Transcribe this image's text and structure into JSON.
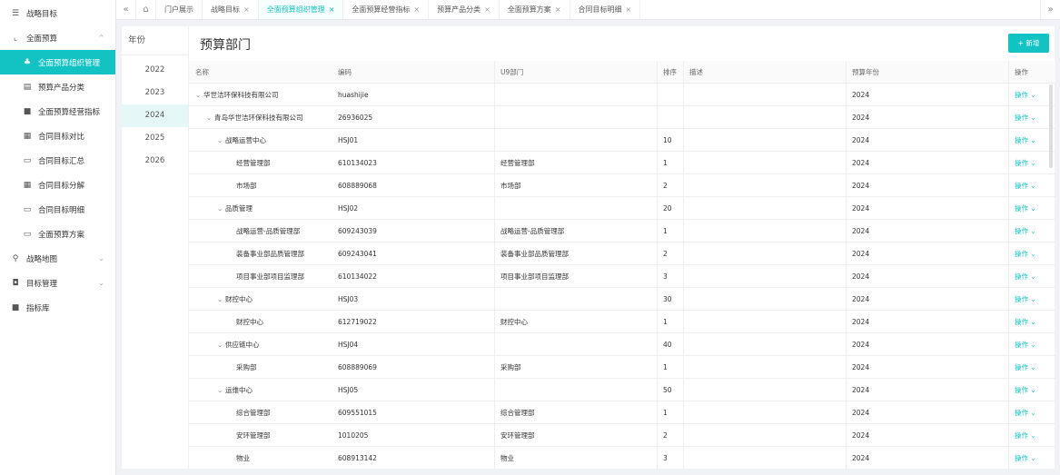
{
  "sidebar": {
    "items": [
      {
        "label": "战略目标",
        "icon": "list-icon",
        "glyph": "☰"
      },
      {
        "label": "全面预算",
        "icon": "budget-icon",
        "glyph": "⌞",
        "chevron": "^"
      },
      {
        "label": "全面预算组织管理",
        "icon": "org-icon",
        "glyph": "♣"
      },
      {
        "label": "预算产品分类",
        "icon": "category-icon",
        "glyph": "▤"
      },
      {
        "label": "全面预算经营指标",
        "icon": "indicator-icon",
        "glyph": "■"
      },
      {
        "label": "合同目标对比",
        "icon": "table-icon",
        "glyph": "▦"
      },
      {
        "label": "合同目标汇总",
        "icon": "doc-icon",
        "glyph": "▭"
      },
      {
        "label": "合同目标分解",
        "icon": "grid-icon",
        "glyph": "▦"
      },
      {
        "label": "合同目标明细",
        "icon": "doc-icon",
        "glyph": "▭"
      },
      {
        "label": "全面预算方案",
        "icon": "doc-icon",
        "glyph": "▭"
      },
      {
        "label": "战略地图",
        "icon": "location-icon",
        "glyph": "⚲",
        "chevron": "⌄"
      },
      {
        "label": "目标管理",
        "icon": "target-icon",
        "glyph": "◘",
        "chevron": "⌄"
      },
      {
        "label": "指标库",
        "icon": "library-icon",
        "glyph": "■"
      }
    ]
  },
  "tabbar": {
    "collapse_glyph": "«",
    "home_glyph": "⌂",
    "expand_glyph": "»",
    "close_glyph": "×",
    "tabs": [
      {
        "label": "门户展示"
      },
      {
        "label": "战略目标"
      },
      {
        "label": "全面预算组织管理"
      },
      {
        "label": "全面预算经营指标"
      },
      {
        "label": "预算产品分类"
      },
      {
        "label": "全面预算方案"
      },
      {
        "label": "合同目标明细"
      }
    ]
  },
  "years": {
    "title": "年份",
    "items": [
      "2022",
      "2023",
      "2024",
      "2025",
      "2026"
    ],
    "selected": "2024"
  },
  "main": {
    "title": "预算部门",
    "add_label": "+ 新增",
    "columns": {
      "name": "名称",
      "code": "编码",
      "u9": "U9部门",
      "sort": "排序",
      "desc": "描述",
      "year": "预算年份",
      "op": "操作"
    },
    "op_label": "操作 ⌄",
    "expanded_glyph": "⌄",
    "rows": [
      {
        "level": 0,
        "expanded": true,
        "name": "华世洁环保科技有限公司",
        "code": "huashijie",
        "u9": "",
        "sort": "",
        "desc": "",
        "year": "2024"
      },
      {
        "level": 1,
        "expanded": true,
        "name": "青岛华世洁环保科技有限公司",
        "code": "26936025",
        "u9": "",
        "sort": "",
        "desc": "",
        "year": "2024"
      },
      {
        "level": 2,
        "expanded": true,
        "name": "战略运营中心",
        "code": "HSJ01",
        "u9": "",
        "sort": "10",
        "desc": "",
        "year": "2024"
      },
      {
        "level": 3,
        "expanded": false,
        "name": "经营管理部",
        "code": "610134023",
        "u9": "经营管理部",
        "sort": "1",
        "desc": "",
        "year": "2024"
      },
      {
        "level": 3,
        "expanded": false,
        "name": "市场部",
        "code": "608889068",
        "u9": "市场部",
        "sort": "2",
        "desc": "",
        "year": "2024"
      },
      {
        "level": 2,
        "expanded": true,
        "name": "品质管理",
        "code": "HSJ02",
        "u9": "",
        "sort": "20",
        "desc": "",
        "year": "2024"
      },
      {
        "level": 3,
        "expanded": false,
        "name": "战略运营-品质管理部",
        "code": "609243039",
        "u9": "战略运营-品质管理部",
        "sort": "1",
        "desc": "",
        "year": "2024"
      },
      {
        "level": 3,
        "expanded": false,
        "name": "装备事业部品质管理部",
        "code": "609243041",
        "u9": "装备事业部品质管理部",
        "sort": "2",
        "desc": "",
        "year": "2024"
      },
      {
        "level": 3,
        "expanded": false,
        "name": "项目事业部项目监理部",
        "code": "610134022",
        "u9": "项目事业部项目监理部",
        "sort": "3",
        "desc": "",
        "year": "2024"
      },
      {
        "level": 2,
        "expanded": true,
        "name": "财控中心",
        "code": "HSJ03",
        "u9": "",
        "sort": "30",
        "desc": "",
        "year": "2024"
      },
      {
        "level": 3,
        "expanded": false,
        "name": "财控中心",
        "code": "612719022",
        "u9": "财控中心",
        "sort": "1",
        "desc": "",
        "year": "2024"
      },
      {
        "level": 2,
        "expanded": true,
        "name": "供应链中心",
        "code": "HSJ04",
        "u9": "",
        "sort": "40",
        "desc": "",
        "year": "2024"
      },
      {
        "level": 3,
        "expanded": false,
        "name": "采购部",
        "code": "608889069",
        "u9": "采购部",
        "sort": "1",
        "desc": "",
        "year": "2024"
      },
      {
        "level": 2,
        "expanded": true,
        "name": "运维中心",
        "code": "HSJ05",
        "u9": "",
        "sort": "50",
        "desc": "",
        "year": "2024"
      },
      {
        "level": 3,
        "expanded": false,
        "name": "综合管理部",
        "code": "609551015",
        "u9": "综合管理部",
        "sort": "1",
        "desc": "",
        "year": "2024"
      },
      {
        "level": 3,
        "expanded": false,
        "name": "安环管理部",
        "code": "1010205",
        "u9": "安环管理部",
        "sort": "2",
        "desc": "",
        "year": "2024"
      },
      {
        "level": 3,
        "expanded": false,
        "name": "物业",
        "code": "608913142",
        "u9": "物业",
        "sort": "3",
        "desc": "",
        "year": "2024"
      }
    ]
  },
  "colors": {
    "accent": "#13c2c2",
    "active_year_bg": "#e6f7f7"
  }
}
